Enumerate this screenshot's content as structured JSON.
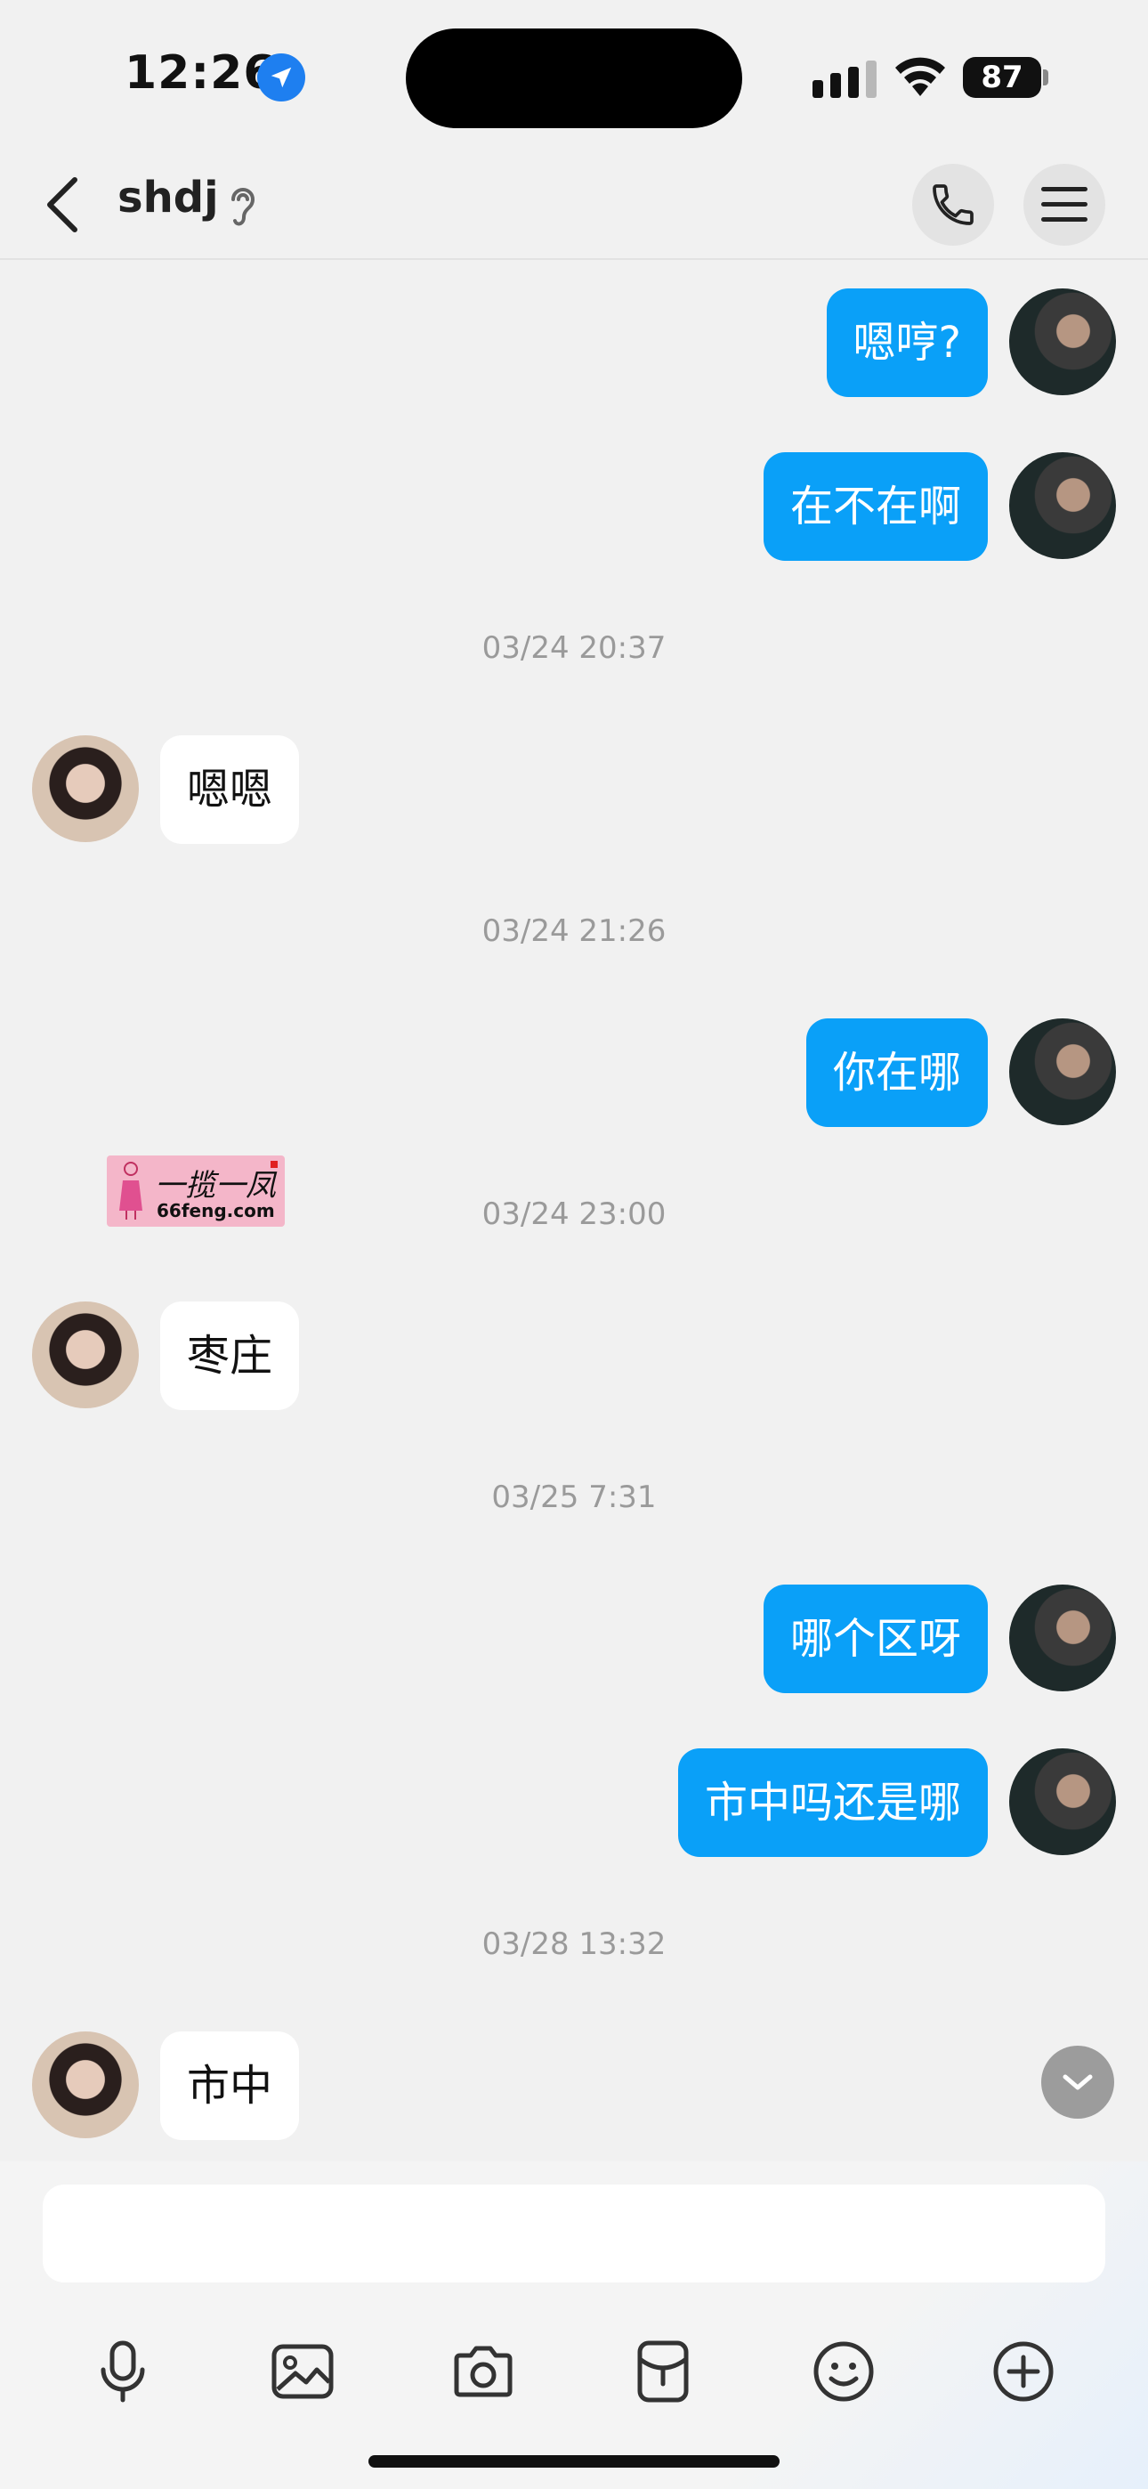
{
  "status_bar": {
    "time": "12:26",
    "battery_level": "87"
  },
  "header": {
    "title": "shdj",
    "icons": [
      "back-arrow",
      "ear",
      "phone",
      "menu"
    ]
  },
  "messages": [
    {
      "type": "message",
      "side": "out",
      "text": "嗯哼?"
    },
    {
      "type": "message",
      "side": "out",
      "text": "在不在啊"
    },
    {
      "type": "timestamp",
      "text": "03/24 20:37"
    },
    {
      "type": "message",
      "side": "in",
      "text": "嗯嗯"
    },
    {
      "type": "timestamp",
      "text": "03/24 21:26"
    },
    {
      "type": "message",
      "side": "out",
      "text": "你在哪"
    },
    {
      "type": "timestamp",
      "text": "03/24 23:00"
    },
    {
      "type": "message",
      "side": "in",
      "text": "枣庄"
    },
    {
      "type": "timestamp",
      "text": "03/25 7:31"
    },
    {
      "type": "message",
      "side": "out",
      "text": "哪个区呀"
    },
    {
      "type": "message",
      "side": "out",
      "text": "市中吗还是哪"
    },
    {
      "type": "timestamp",
      "text": "03/28 13:32"
    },
    {
      "type": "message",
      "side": "in",
      "text": "市中"
    }
  ],
  "watermark": {
    "title": "一揽一凤",
    "subtitle": "66feng.com"
  },
  "input": {
    "value": "",
    "placeholder": ""
  },
  "toolbar": {
    "icons": [
      "microphone",
      "image",
      "camera",
      "red-packet",
      "emoji",
      "plus"
    ]
  },
  "colors": {
    "outgoing_bubble": "#0aa0f8",
    "incoming_bubble": "#ffffff",
    "background": "#f1f1f1"
  }
}
